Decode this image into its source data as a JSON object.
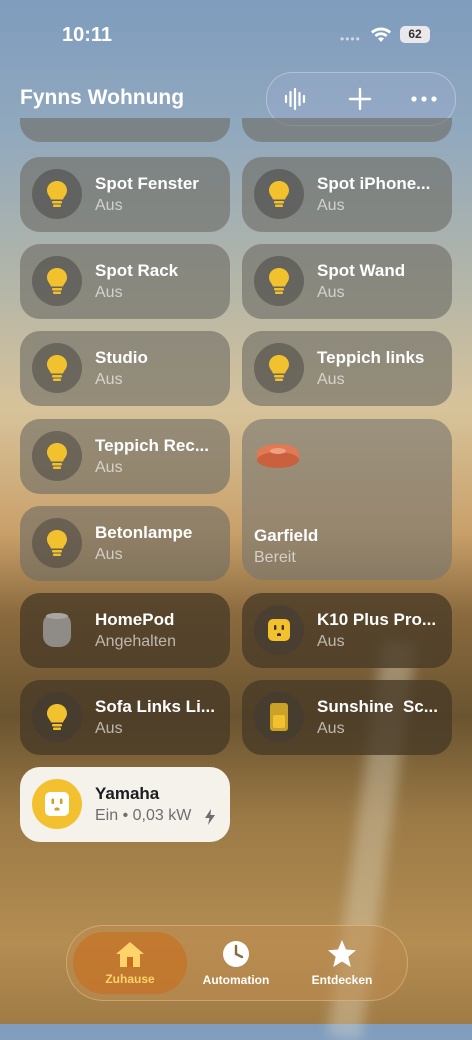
{
  "status": {
    "time": "10:11",
    "battery": "62"
  },
  "home": {
    "title": "Fynns Wohnung"
  },
  "toolbar": {
    "icons": [
      "waveform-icon",
      "plus-icon",
      "ellipsis-icon"
    ]
  },
  "tiles": [
    {
      "name": "Spot Fenster",
      "state": "Aus",
      "icon": "lightbulb-icon"
    },
    {
      "name": "Spot iPhone...",
      "state": "Aus",
      "icon": "lightbulb-icon"
    },
    {
      "name": "Spot Rack",
      "state": "Aus",
      "icon": "lightbulb-icon"
    },
    {
      "name": "Spot Wand",
      "state": "Aus",
      "icon": "lightbulb-icon"
    },
    {
      "name": "Studio",
      "state": "Aus",
      "icon": "lightbulb-icon"
    },
    {
      "name": "Teppich links",
      "state": "Aus",
      "icon": "lightbulb-icon"
    },
    {
      "name": "Teppich Rec...",
      "state": "Aus",
      "icon": "lightbulb-icon"
    },
    {
      "name": "Garfield",
      "state": "Bereit",
      "icon": "robot-vacuum-icon"
    },
    {
      "name": "Betonlampe",
      "state": "Aus",
      "icon": "lightbulb-icon"
    },
    {
      "name": "HomePod",
      "state": "Angehalten",
      "icon": "homepod-icon"
    },
    {
      "name": "K10 Plus Pro...",
      "state": "Aus",
      "icon": "outlet-icon"
    },
    {
      "name": "Sofa Links Li...",
      "state": "Aus",
      "icon": "lightbulb-icon"
    },
    {
      "name": "Sunshine  Sc...",
      "state": "Aus",
      "icon": "switch-icon"
    },
    {
      "name": "Yamaha",
      "state": "Ein • 0,03 kW",
      "icon": "outlet-icon"
    }
  ],
  "tabs": [
    {
      "label": "Zuhause",
      "icon": "house-icon"
    },
    {
      "label": "Automation",
      "icon": "clock-icon"
    },
    {
      "label": "Entdecken",
      "icon": "star-icon"
    }
  ],
  "colors": {
    "bulb": "#f2c12e",
    "vacuum": "#e07a55",
    "outlet_on": "#f3c02f",
    "tab_active": "#ffd36a"
  }
}
